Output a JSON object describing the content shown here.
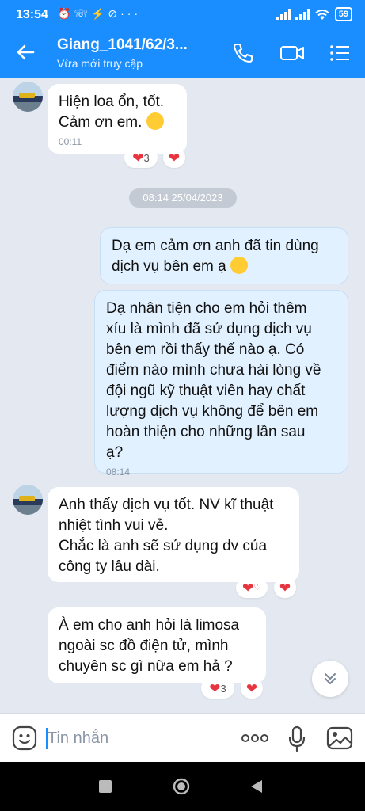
{
  "status_bar": {
    "time": "13:54",
    "icons_left": [
      "alarm-icon",
      "missed-call-icon",
      "messenger-icon",
      "clock-app-icon",
      "more-dots"
    ],
    "more": "···",
    "battery": "59"
  },
  "header": {
    "title": "Giang_1041/62/3...",
    "subtitle": "Vừa mới truy cập"
  },
  "date_divider": "08:14 25/04/2023",
  "messages": [
    {
      "line1": "Hiện loa ổn, tốt.",
      "line2": "Cảm ơn em.",
      "time": "00:11",
      "reaction_count": "3"
    },
    {
      "line1": "Dạ em cảm ơn anh  đã tin dùng",
      "line2": "dịch vụ bên em ạ"
    },
    {
      "lines": [
        "Dạ nhân tiện cho em hỏi thêm",
        "xíu là mình đã sử dụng dịch vụ",
        "bên em rồi thấy thế nào ạ. Có",
        "điểm nào mình chưa hài lòng về",
        "đội ngũ kỹ thuật viên hay chất",
        "lượng dịch vụ không để bên em",
        "hoàn thiện cho những lần sau",
        "ạ?"
      ],
      "time": "08:14"
    },
    {
      "lines": [
        "Anh thấy dịch vụ tốt. NV kĩ thuật",
        "nhiệt tình vui vẻ.",
        "Chắc là anh sẽ sử dụng dv của",
        "công ty lâu dài."
      ]
    },
    {
      "lines": [
        "À em cho anh hỏi là limosa",
        "ngoài sc đồ điện tử, mình",
        "chuyên sc gì nữa em hả ?"
      ],
      "reaction_count": "3"
    }
  ],
  "input": {
    "placeholder": "Tin nhắn"
  },
  "colors": {
    "brand": "#1a8dff",
    "heart": "#e8343f",
    "my_bubble": "#e2f1ff",
    "chat_bg": "#e4e9f1"
  }
}
